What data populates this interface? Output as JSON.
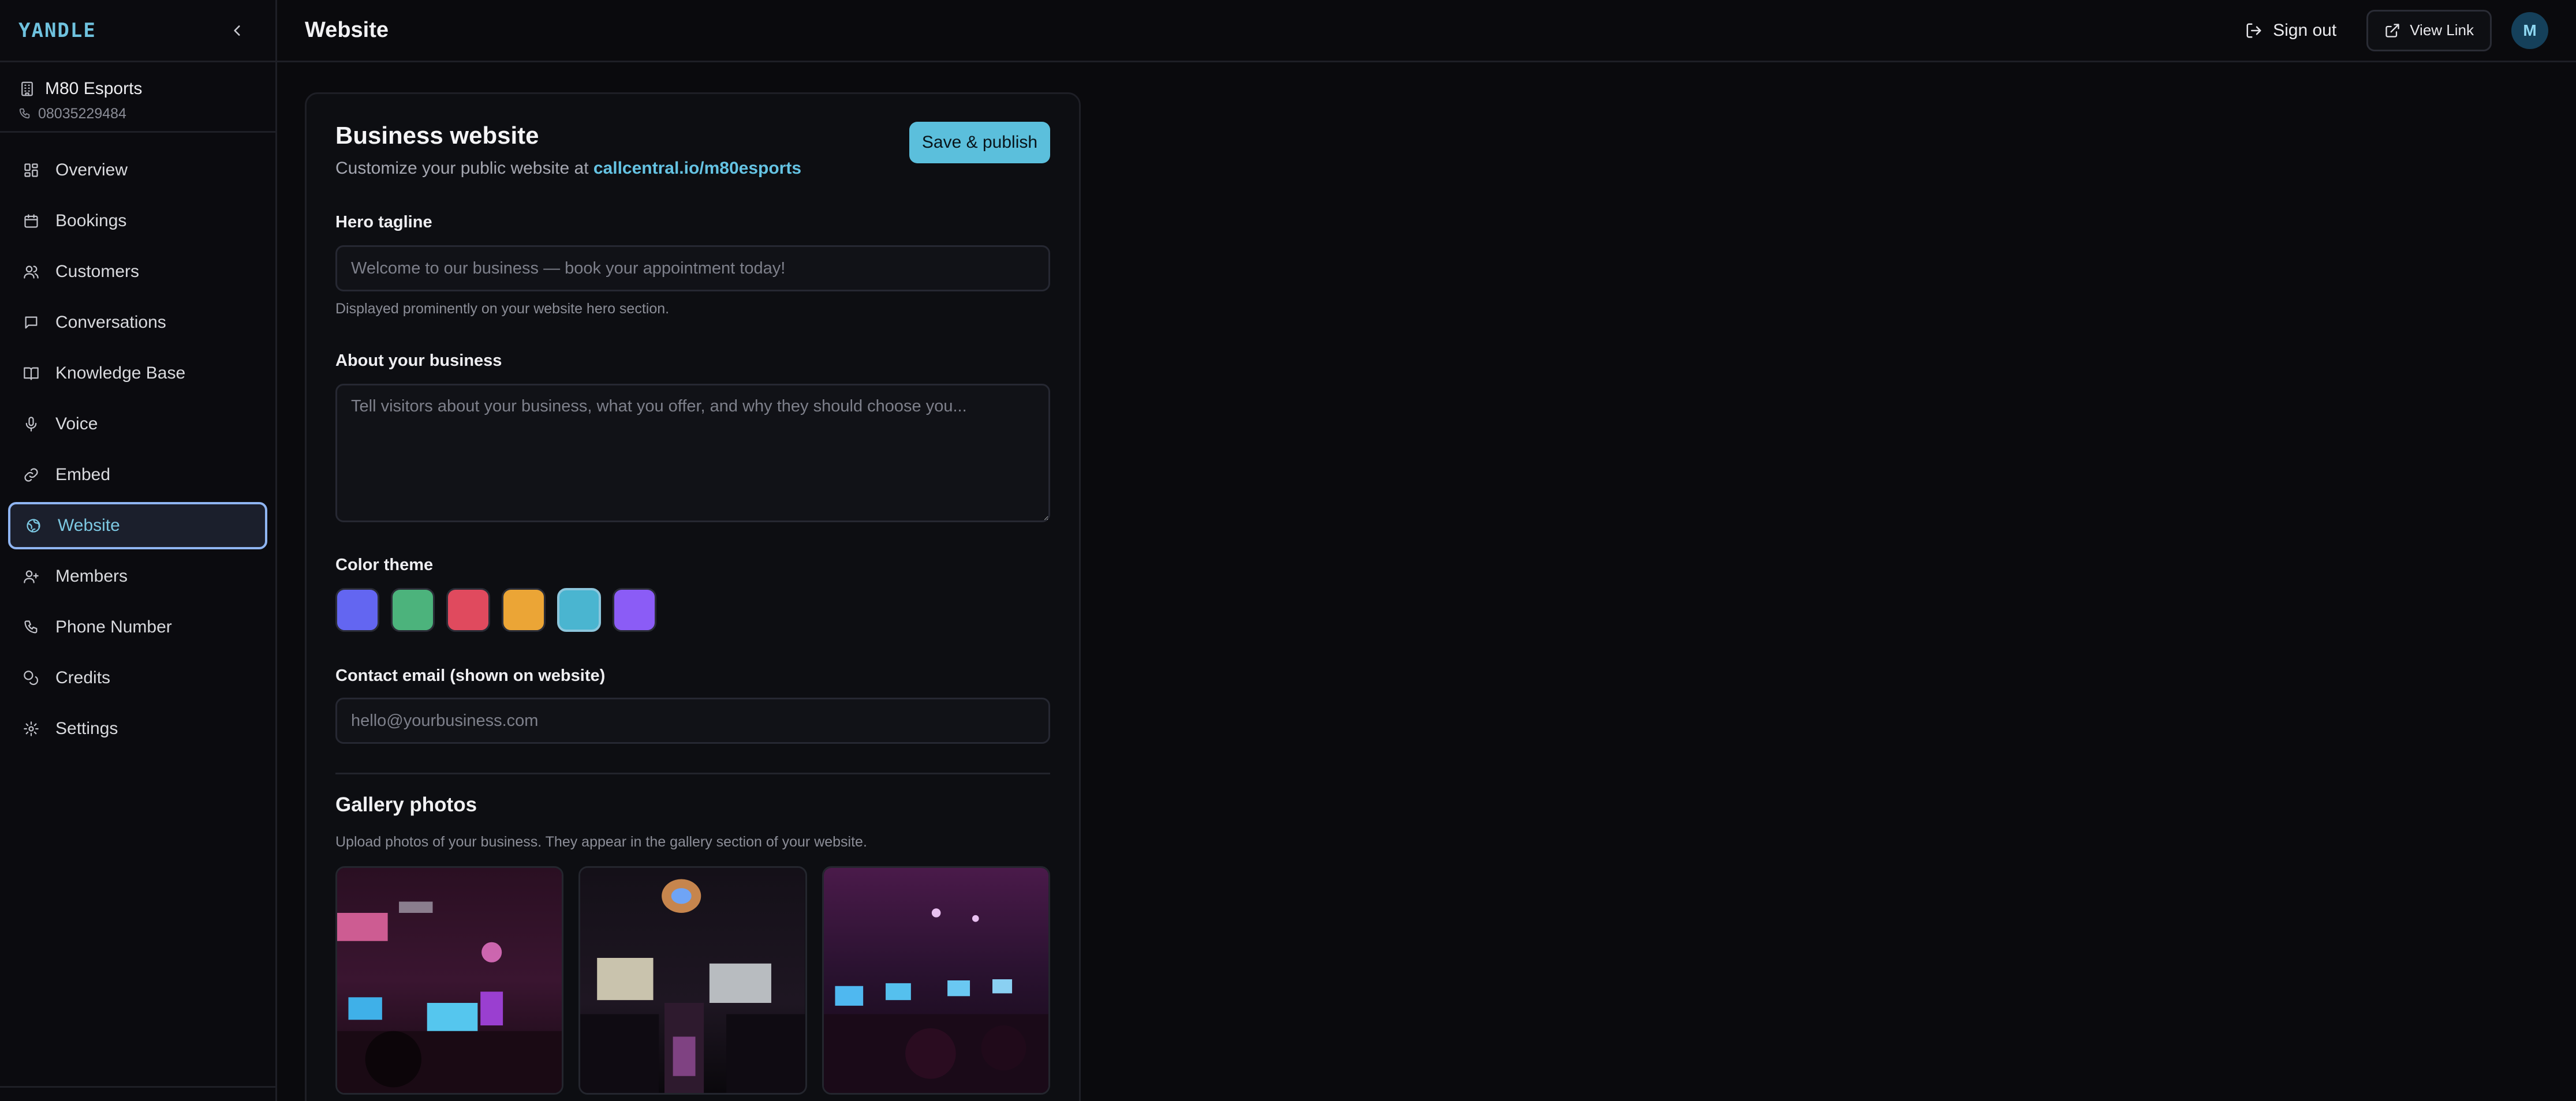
{
  "brand": {
    "logo": "YANDLE"
  },
  "org": {
    "name": "M80 Esports",
    "phone": "08035229484"
  },
  "nav": {
    "items": [
      {
        "label": "Overview",
        "icon": "grid-icon"
      },
      {
        "label": "Bookings",
        "icon": "calendar-icon"
      },
      {
        "label": "Customers",
        "icon": "users-icon"
      },
      {
        "label": "Conversations",
        "icon": "chat-icon"
      },
      {
        "label": "Knowledge Base",
        "icon": "book-icon"
      },
      {
        "label": "Voice",
        "icon": "mic-icon"
      },
      {
        "label": "Embed",
        "icon": "link-icon"
      },
      {
        "label": "Website",
        "icon": "globe-icon",
        "active": true
      },
      {
        "label": "Members",
        "icon": "user-plus-icon"
      },
      {
        "label": "Phone Number",
        "icon": "phone-icon"
      },
      {
        "label": "Credits",
        "icon": "coins-icon"
      },
      {
        "label": "Settings",
        "icon": "gear-icon"
      }
    ]
  },
  "header": {
    "title": "Website",
    "signout_label": "Sign out",
    "viewlink_label": "View Link",
    "avatar_initial": "M"
  },
  "card": {
    "title": "Business website",
    "subtitle_prefix": "Customize your public website at",
    "subtitle_link": "callcentral.io/m80esports",
    "publish_label": "Save & publish"
  },
  "form": {
    "tagline": {
      "label": "Hero tagline",
      "value": "",
      "placeholder": "Welcome to our business — book your appointment today!",
      "help": "Displayed prominently on your website hero section."
    },
    "about": {
      "label": "About your business",
      "value": "",
      "placeholder": "Tell visitors about your business, what you offer, and why they should choose you..."
    },
    "theme": {
      "label": "Color theme",
      "colors": [
        "#6366f1",
        "#4cb37c",
        "#e04a5e",
        "#eba536",
        "#4ab5d0",
        "#8b5cf6"
      ],
      "selected_index": 4
    },
    "email": {
      "label": "Contact email (shown on website)",
      "value": "",
      "placeholder": "hello@yourbusiness.com"
    }
  },
  "gallery": {
    "title": "Gallery photos",
    "help": "Upload photos of your business. They appear in the gallery section of your website."
  }
}
